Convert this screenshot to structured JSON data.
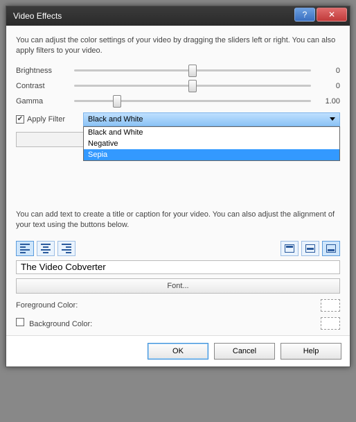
{
  "title": "Video Effects",
  "desc1": "You can adjust the color settings of your video by dragging the sliders left or right. You can also apply filters to your video.",
  "sliders": {
    "brightness": {
      "label": "Brightness",
      "value": "0",
      "pos": 50
    },
    "contrast": {
      "label": "Contrast",
      "value": "0",
      "pos": 50
    },
    "gamma": {
      "label": "Gamma",
      "value": "1.00",
      "pos": 18
    }
  },
  "filter": {
    "checkbox_label": "Apply Filter",
    "selected": "Black and White",
    "options": [
      "Black and White",
      "Negative",
      "Sepia"
    ],
    "hover_index": 2
  },
  "desc2": "You can add text to create a title or caption for your video. You can also adjust the alignment of your text using the buttons below.",
  "caption_value": "The Video Cobverter",
  "font_button": "Font...",
  "fg_label": "Foreground Color:",
  "bg_label": "Background Color:",
  "buttons": {
    "ok": "OK",
    "cancel": "Cancel",
    "help": "Help"
  }
}
